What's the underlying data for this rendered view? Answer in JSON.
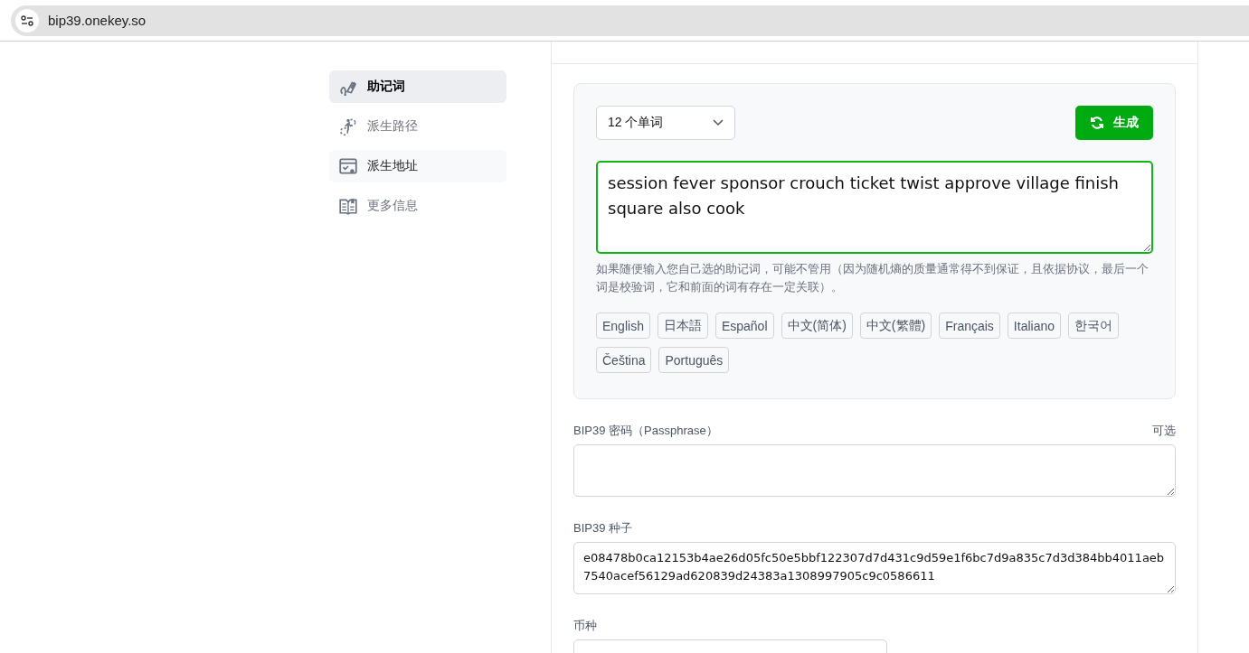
{
  "browser": {
    "url": "bip39.onekey.so"
  },
  "sidebar": {
    "items": [
      {
        "label": "助记词",
        "selected": true,
        "hovered": false
      },
      {
        "label": "派生路径",
        "selected": false,
        "hovered": false
      },
      {
        "label": "派生地址",
        "selected": false,
        "hovered": true
      },
      {
        "label": "更多信息",
        "selected": false,
        "hovered": false
      }
    ]
  },
  "mnemonic": {
    "word_count": "12 个单词",
    "generate_button": "生成",
    "value": "session fever sponsor crouch ticket twist approve village finish square also cook",
    "focused": true,
    "hint": "如果随便输入您自己选的助记词，可能不管用（因为随机熵的质量通常得不到保证，且依据协议，最后一个词是校验词，它和前面的词有存在一定关联）。",
    "languages": [
      {
        "label": "English",
        "selected": false
      },
      {
        "label": "日本語",
        "selected": false
      },
      {
        "label": "Español",
        "selected": false
      },
      {
        "label": "中文(简体)",
        "selected": false
      },
      {
        "label": "中文(繁體)",
        "selected": false
      },
      {
        "label": "Français",
        "selected": false
      },
      {
        "label": "Italiano",
        "selected": false
      },
      {
        "label": "한국어",
        "selected": false
      },
      {
        "label": "Čeština",
        "selected": false
      },
      {
        "label": "Português",
        "selected": false
      }
    ]
  },
  "passphrase": {
    "label": "BIP39 密码（Passphrase）",
    "optional": "可选"
  },
  "seed": {
    "label": "BIP39 种子",
    "value": "e08478b0ca12153b4ae26d05fc50e5bbf122307d7d431c9d59e1f6bc7d9a835c7d3d384bb4011aeb7540acef56129ad620839d24383a1308997905c9c0586611"
  },
  "coin": {
    "label": "币种"
  }
}
